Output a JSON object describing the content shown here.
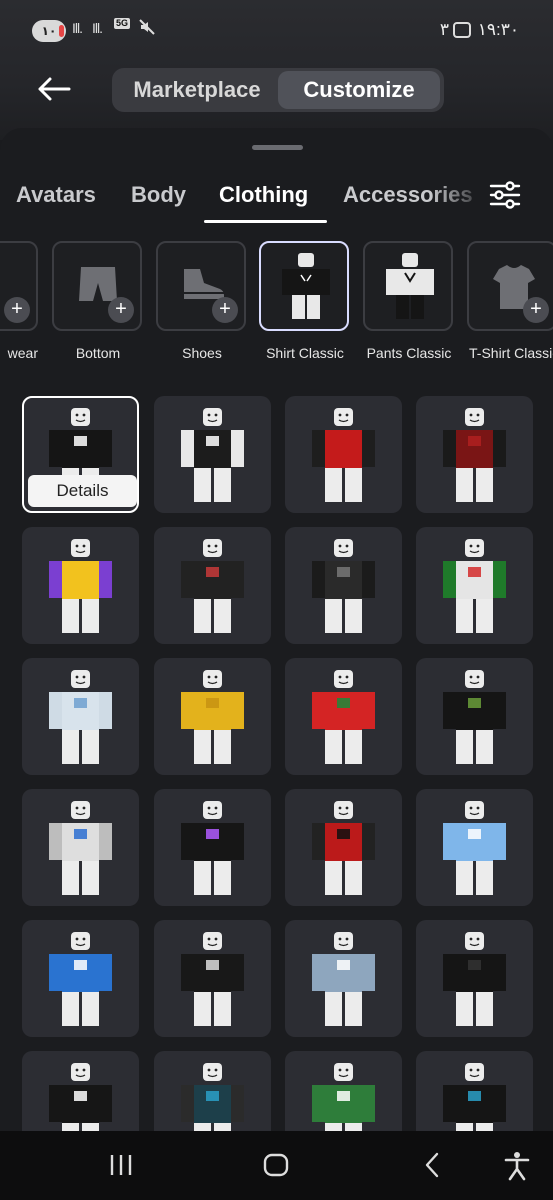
{
  "status": {
    "battery": "۱۰",
    "network": "5G",
    "time": "۱۹:۳۰",
    "notif_count": "۳"
  },
  "header": {
    "tabs": [
      {
        "label": "Marketplace",
        "active": false
      },
      {
        "label": "Customize",
        "active": true
      }
    ]
  },
  "categories": [
    {
      "label": "Avatars",
      "active": false
    },
    {
      "label": "Body",
      "active": false
    },
    {
      "label": "Clothing",
      "active": true
    },
    {
      "label": "Accessories",
      "active": false
    }
  ],
  "subcategories": [
    {
      "label": "wear",
      "active": false
    },
    {
      "label": "Bottom",
      "active": false
    },
    {
      "label": "Shoes",
      "active": false
    },
    {
      "label": "Shirt Classic",
      "active": true
    },
    {
      "label": "Pants Classic",
      "active": false
    },
    {
      "label": "T-Shirt Classic",
      "active": false
    }
  ],
  "grid": {
    "details_label": "Details",
    "items": [
      {
        "torso": "#151515",
        "arms": "#151515",
        "accent": "#ffffff",
        "selected": true
      },
      {
        "torso": "#1c1c1c",
        "arms": "#e8e8e8",
        "accent": "#ffffff"
      },
      {
        "torso": "#c41b1b",
        "arms": "#1e1e1e",
        "accent": "#c41b1b"
      },
      {
        "torso": "#7a1515",
        "arms": "#1a1a1a",
        "accent": "#b02020"
      },
      {
        "torso": "#f2c21e",
        "arms": "#7b3fd1",
        "accent": "#f2c21e"
      },
      {
        "torso": "#222222",
        "arms": "#222222",
        "accent": "#c83a3a"
      },
      {
        "torso": "#2a2a2a",
        "arms": "#1b1b1b",
        "accent": "#777777"
      },
      {
        "torso": "#e5e5e5",
        "arms": "#1f7a2a",
        "accent": "#d32b2b"
      },
      {
        "torso": "#d8e3ec",
        "arms": "#cfdbe5",
        "accent": "#6fa0d0"
      },
      {
        "torso": "#e3b21c",
        "arms": "#e3b21c",
        "accent": "#c79212"
      },
      {
        "torso": "#d42424",
        "arms": "#d42424",
        "accent": "#1c8a3a"
      },
      {
        "torso": "#151515",
        "arms": "#151515",
        "accent": "#6a9e3a"
      },
      {
        "torso": "#dedede",
        "arms": "#bdbdbd",
        "accent": "#2d6fd1"
      },
      {
        "torso": "#161616",
        "arms": "#161616",
        "accent": "#b25cff"
      },
      {
        "torso": "#bb1a1a",
        "arms": "#222222",
        "accent": "#101010"
      },
      {
        "torso": "#7fb6ea",
        "arms": "#7fb6ea",
        "accent": "#ffffff"
      },
      {
        "torso": "#2a73d0",
        "arms": "#2a73d0",
        "accent": "#ffffff"
      },
      {
        "torso": "#181818",
        "arms": "#181818",
        "accent": "#dddddd"
      },
      {
        "torso": "#8ea6be",
        "arms": "#8ea6be",
        "accent": "#ffffff"
      },
      {
        "torso": "#151515",
        "arms": "#151515",
        "accent": "#333333"
      },
      {
        "torso": "#161616",
        "arms": "#161616",
        "accent": "#ffffff"
      },
      {
        "torso": "#1d3f4a",
        "arms": "#2b2b2b",
        "accent": "#2aa0c8"
      },
      {
        "torso": "#2e7d3a",
        "arms": "#2e7d3a",
        "accent": "#ffffff"
      },
      {
        "torso": "#151515",
        "arms": "#151515",
        "accent": "#2aa0c8"
      }
    ]
  }
}
